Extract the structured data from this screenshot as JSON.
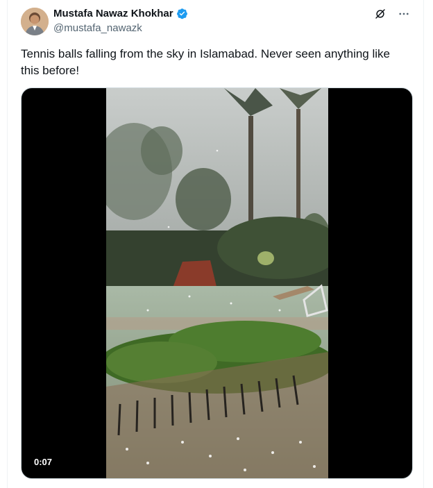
{
  "author": {
    "name": "Mustafa Nawaz Khokhar",
    "handle": "@mustafa_nawazk",
    "verified": true
  },
  "post": {
    "text": "Tennis balls falling from the sky in Islamabad. Never seen anything like this before!"
  },
  "media": {
    "type": "video",
    "duration": "0:07"
  },
  "icons": [
    "grok-icon",
    "more-options-icon",
    "verified-badge-icon"
  ],
  "colors": {
    "verified_blue": "#1d9bf0",
    "secondary_text": "#536471",
    "primary_text": "#0f1419"
  }
}
